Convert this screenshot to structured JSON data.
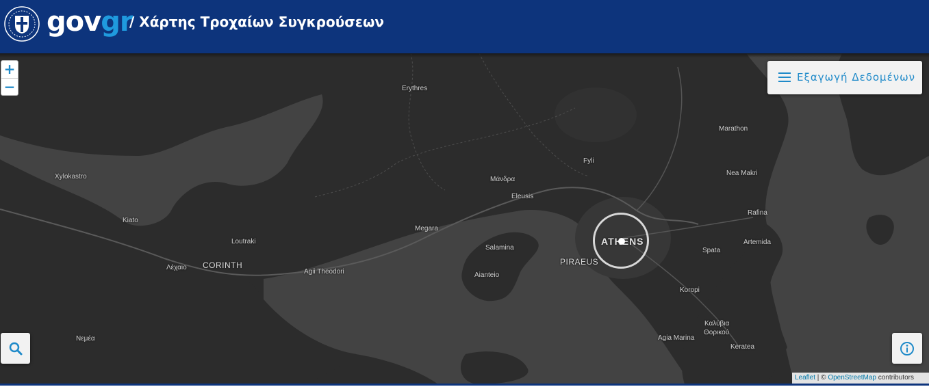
{
  "header": {
    "logo_gov": "gov",
    "logo_gr": "gr",
    "title": "/ Χάρτης Τροχαίων Συγκρούσεων"
  },
  "controls": {
    "zoom_in": "+",
    "zoom_out": "−",
    "export_label": "Εξαγωγή Δεδομένων"
  },
  "attribution": {
    "leaflet": "Leaflet",
    "separator": " | © ",
    "osm": "OpenStreetMap",
    "suffix": " contributors"
  },
  "places": {
    "erythres": "Erythres",
    "marathon": "Marathon",
    "fyli": "Fyli",
    "nea_makri": "Nea Makri",
    "xylokastro": "Xylokastro",
    "mandra": "Μάνδρα",
    "eleusis": "Eleusis",
    "kiato": "Kiato",
    "rafina": "Rafina",
    "megara": "Megara",
    "loutraki": "Loutraki",
    "salamina": "Salamina",
    "athens": "ATHENS",
    "artemida": "Artemida",
    "spata": "Spata",
    "piraeus": "PIRAEUS",
    "lechaio": "Λέχαιο",
    "corinth": "CORINTH",
    "agii_theodori": "Agii Theodori",
    "aianteio": "Aianteio",
    "koropi": "Koropi",
    "kalyvia": "Καλύβια",
    "thorikou": "Θορικού",
    "nemea": "Νεμέα",
    "agia_marina": "Agia Marina",
    "keratea": "Keratea"
  },
  "colors": {
    "header_bg": "#0d347c",
    "accent": "#1f8ac9",
    "land": "#2b2b2b",
    "sea": "#444444"
  },
  "icons": {
    "emblem": "greek-coat-of-arms-icon",
    "menu": "menu-icon",
    "search": "search-icon",
    "info": "info-icon"
  }
}
